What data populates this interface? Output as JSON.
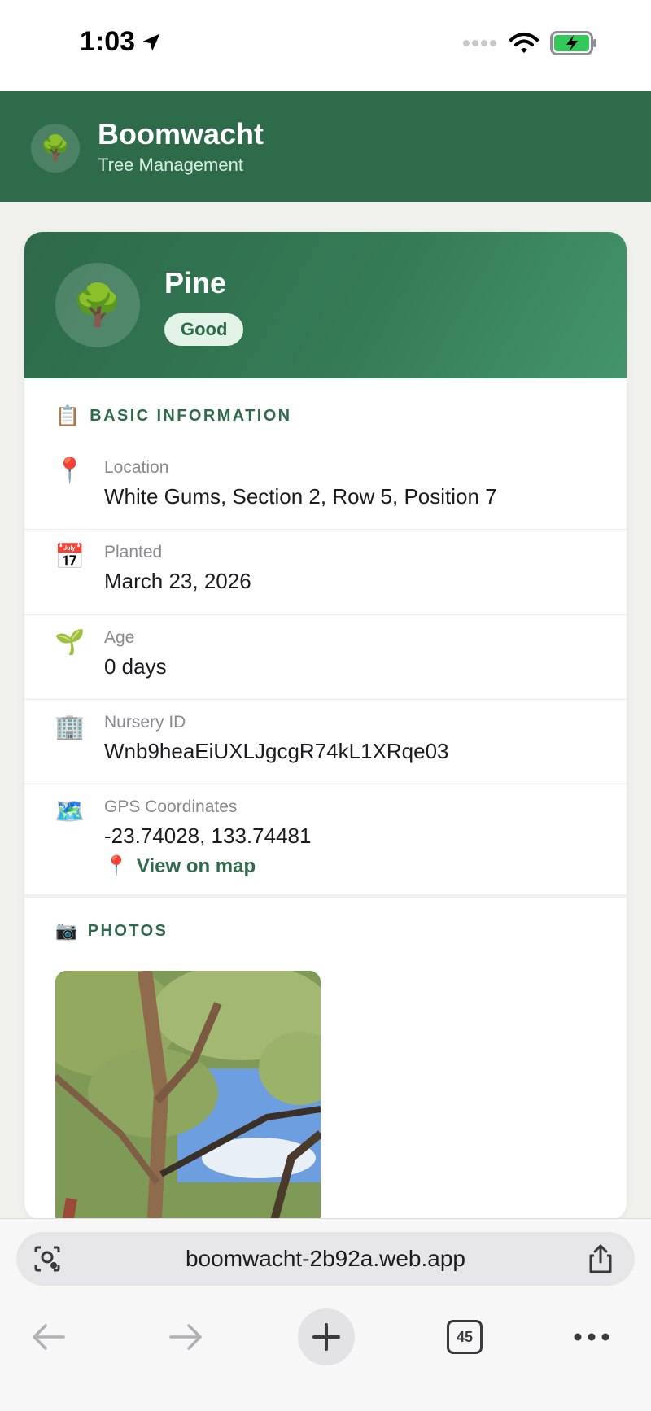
{
  "status_bar": {
    "time": "1:03"
  },
  "app": {
    "title": "Boomwacht",
    "subtitle": "Tree Management",
    "logo_icon": "🌳"
  },
  "tree": {
    "name": "Pine",
    "status": "Good",
    "avatar_icon": "🌳"
  },
  "basic_info": {
    "section_icon": "📋",
    "section_title": "BASIC INFORMATION",
    "rows": [
      {
        "icon": "📍",
        "label": "Location",
        "value": "White Gums, Section 2, Row 5, Position 7"
      },
      {
        "icon": "📅",
        "label": "Planted",
        "value": "March 23, 2026"
      },
      {
        "icon": "🌱",
        "label": "Age",
        "value": "0 days"
      },
      {
        "icon": "🏢",
        "label": "Nursery ID",
        "value": "Wnb9heaEiUXLJgcgR74kL1XRqe03"
      },
      {
        "icon": "🗺️",
        "label": "GPS Coordinates",
        "value": "-23.74028, 133.74481"
      }
    ],
    "map_link": {
      "icon": "📍",
      "label": "View on map"
    }
  },
  "photos": {
    "section_icon": "📷",
    "section_title": "PHOTOS"
  },
  "browser": {
    "url": "boomwacht-2b92a.web.app",
    "tab_count": "45"
  },
  "colors": {
    "brand": "#2e6b4b",
    "badge_bg": "#e3f3e8",
    "background": "#f1f1ee"
  }
}
